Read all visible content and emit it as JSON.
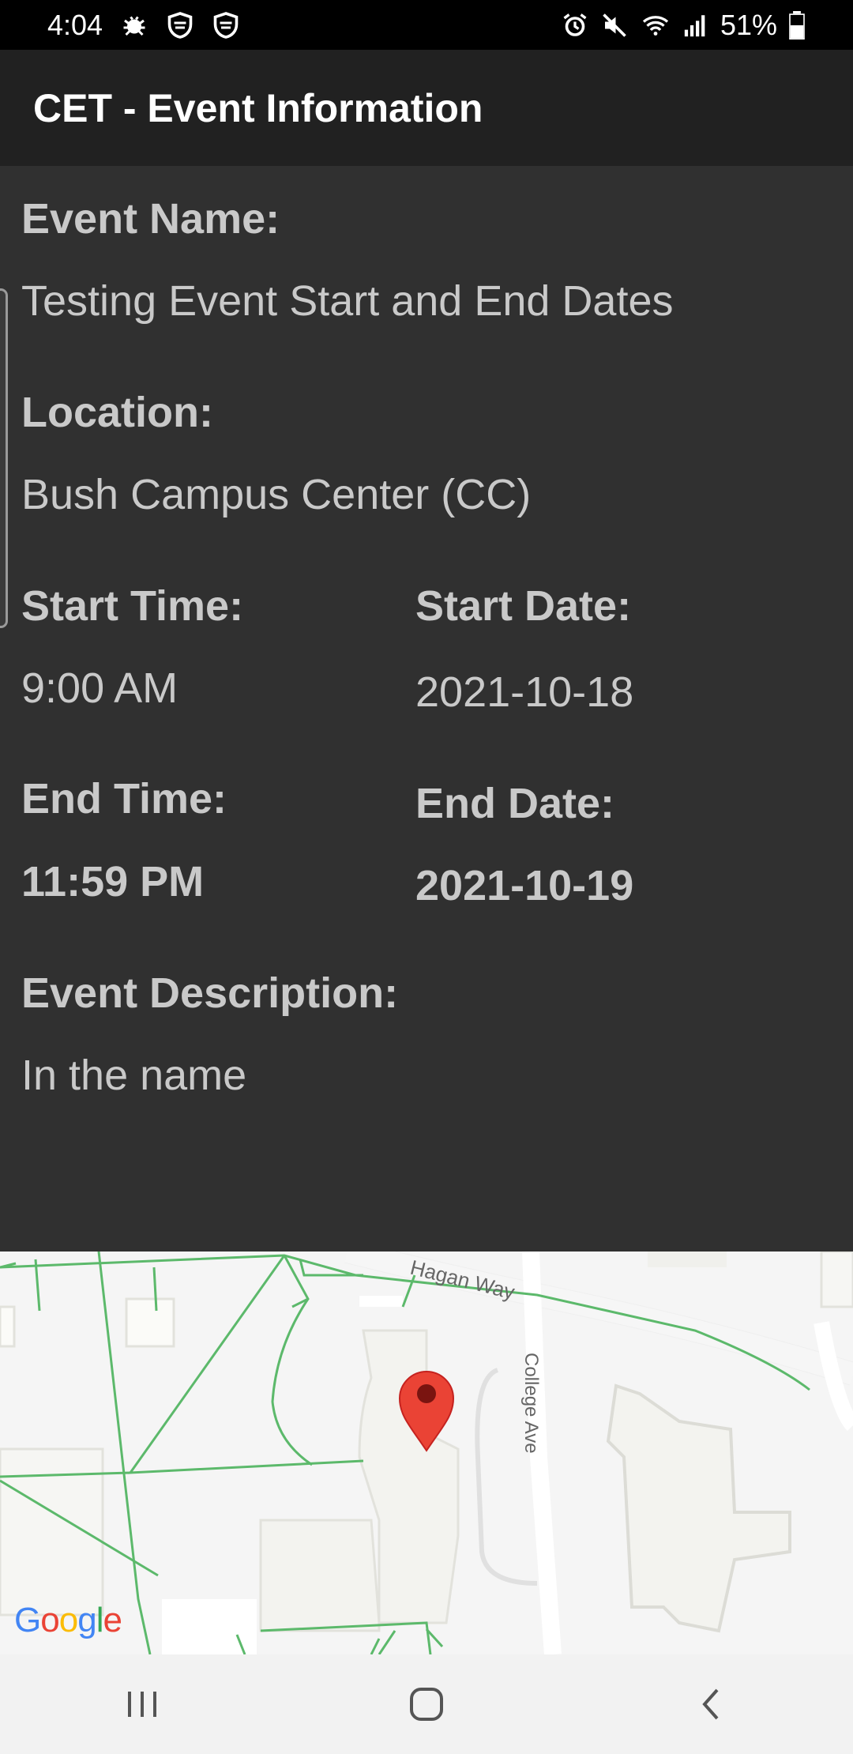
{
  "status_bar": {
    "time": "4:04",
    "battery": "51%"
  },
  "app_bar": {
    "title": "CET - Event Information"
  },
  "event": {
    "name_label": "Event Name:",
    "name_value": "Testing Event Start and End Dates",
    "location_label": "Location:",
    "location_value": "Bush Campus Center (CC)",
    "start_time_label": "Start Time:",
    "start_time_value": "9:00 AM",
    "start_date_label": "Start Date:",
    "start_date_value": "2021-10-18",
    "end_time_label": "End Time:",
    "end_time_value": "11:59 PM",
    "end_date_label": "End Date:",
    "end_date_value": "2021-10-19",
    "description_label": "Event Description:",
    "description_value": "In the name"
  },
  "map": {
    "street_1": "Hagan Way",
    "street_2": "College Ave",
    "logo": {
      "G": "G",
      "o1": "o",
      "o2": "o",
      "g": "g",
      "l": "l",
      "e": "e"
    },
    "marker_icon": "map-pin-icon"
  },
  "colors": {
    "background": "#303030",
    "app_bar": "#212121",
    "text": "#c9c9c9",
    "map_background": "#f5f5f5",
    "path_green": "#5cb96b",
    "marker_red": "#ea4335"
  }
}
